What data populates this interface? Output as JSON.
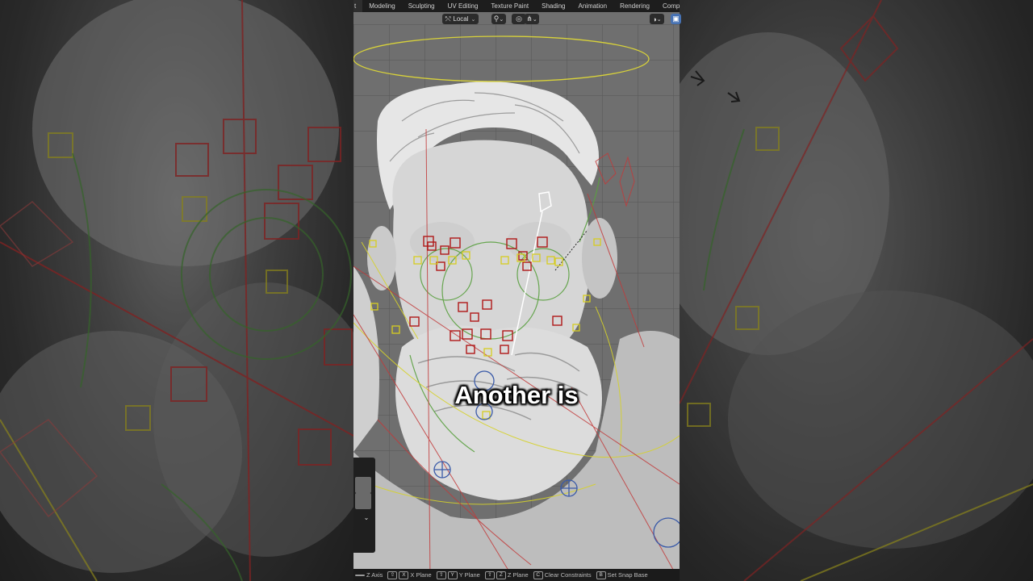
{
  "workspace_tabs": [
    "t",
    "Modeling",
    "Sculpting",
    "UV Editing",
    "Texture Paint",
    "Shading",
    "Animation",
    "Rendering",
    "Compo"
  ],
  "header": {
    "transform_orientation": "Local",
    "proportional_icon": "proportional-edit-icon",
    "snap_icon": "snap-icon",
    "overlay_icon": "overlay-icon",
    "view_icon": "view-icon"
  },
  "caption": "Another is",
  "statusbar": {
    "items": [
      {
        "keys": [
          ""
        ],
        "label": "Z Axis"
      },
      {
        "keys": [
          "⇧",
          "X"
        ],
        "label": "X Plane"
      },
      {
        "keys": [
          "⇧",
          "Y"
        ],
        "label": "Y Plane"
      },
      {
        "keys": [
          "⇧",
          "Z"
        ],
        "label": "Z Plane"
      },
      {
        "keys": [
          "C"
        ],
        "label": "Clear Constraints"
      },
      {
        "keys": [
          "B"
        ],
        "label": "Set Snap Base"
      }
    ]
  },
  "colors": {
    "rig_red": "#c23a3a",
    "rig_yellow": "#d6d22a",
    "rig_green": "#4a9a3a",
    "rig_blue": "#3a5aa8",
    "active_button": "#4772b3"
  }
}
